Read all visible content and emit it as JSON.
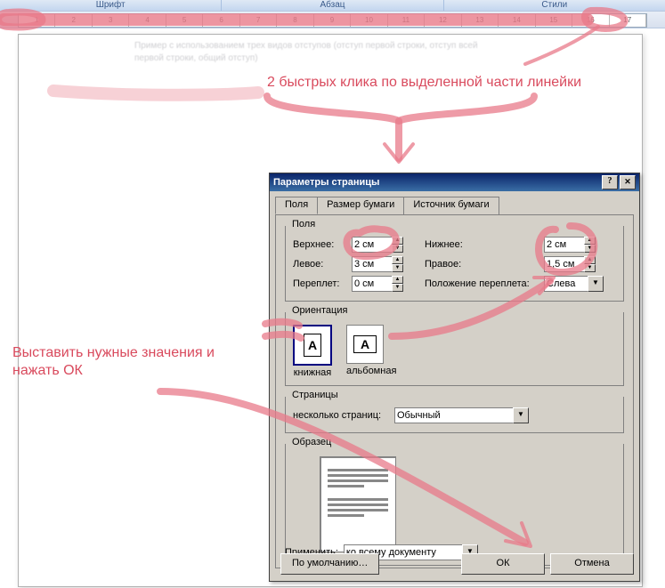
{
  "ribbon": {
    "groups": [
      "Шрифт",
      "Абзац",
      "Стили"
    ]
  },
  "ruler": {
    "ticks": [
      "1",
      "2",
      "3",
      "4",
      "5",
      "6",
      "7",
      "8",
      "9",
      "10",
      "11",
      "12",
      "13",
      "14",
      "15",
      "16",
      "17"
    ]
  },
  "doc_sample_line1": "Пример с использованием трех видов отступов (отступ первой строки, отступ всей",
  "doc_sample_line2": "первой строки, общий отступ)",
  "dialog": {
    "title": "Параметры страницы",
    "tabs": [
      "Поля",
      "Размер бумаги",
      "Источник бумаги"
    ],
    "group_margins": "Поля",
    "top_lbl": "Верхнее:",
    "top_val": "2 см",
    "bottom_lbl": "Нижнее:",
    "bottom_val": "2 см",
    "left_lbl": "Левое:",
    "left_val": "3 см",
    "right_lbl": "Правое:",
    "right_val": "1,5 см",
    "gutter_lbl": "Переплет:",
    "gutter_val": "0 см",
    "gutterpos_lbl": "Положение переплета:",
    "gutterpos_val": "Слева",
    "group_orient": "Ориентация",
    "portrait": "книжная",
    "landscape": "альбомная",
    "group_pages": "Страницы",
    "multi_lbl": "несколько страниц:",
    "multi_val": "Обычный",
    "group_preview": "Образец",
    "apply_lbl": "Применить:",
    "apply_val": "ко всему документу",
    "defaults_btn": "По умолчанию…",
    "ok_btn": "ОК",
    "cancel_btn": "Отмена"
  },
  "annotations": {
    "ruler_tip": "2 быстрых клика по выделенной части линейки",
    "left_tip_1": "Выставить нужные значения и",
    "left_tip_2": "нажать ОК"
  }
}
